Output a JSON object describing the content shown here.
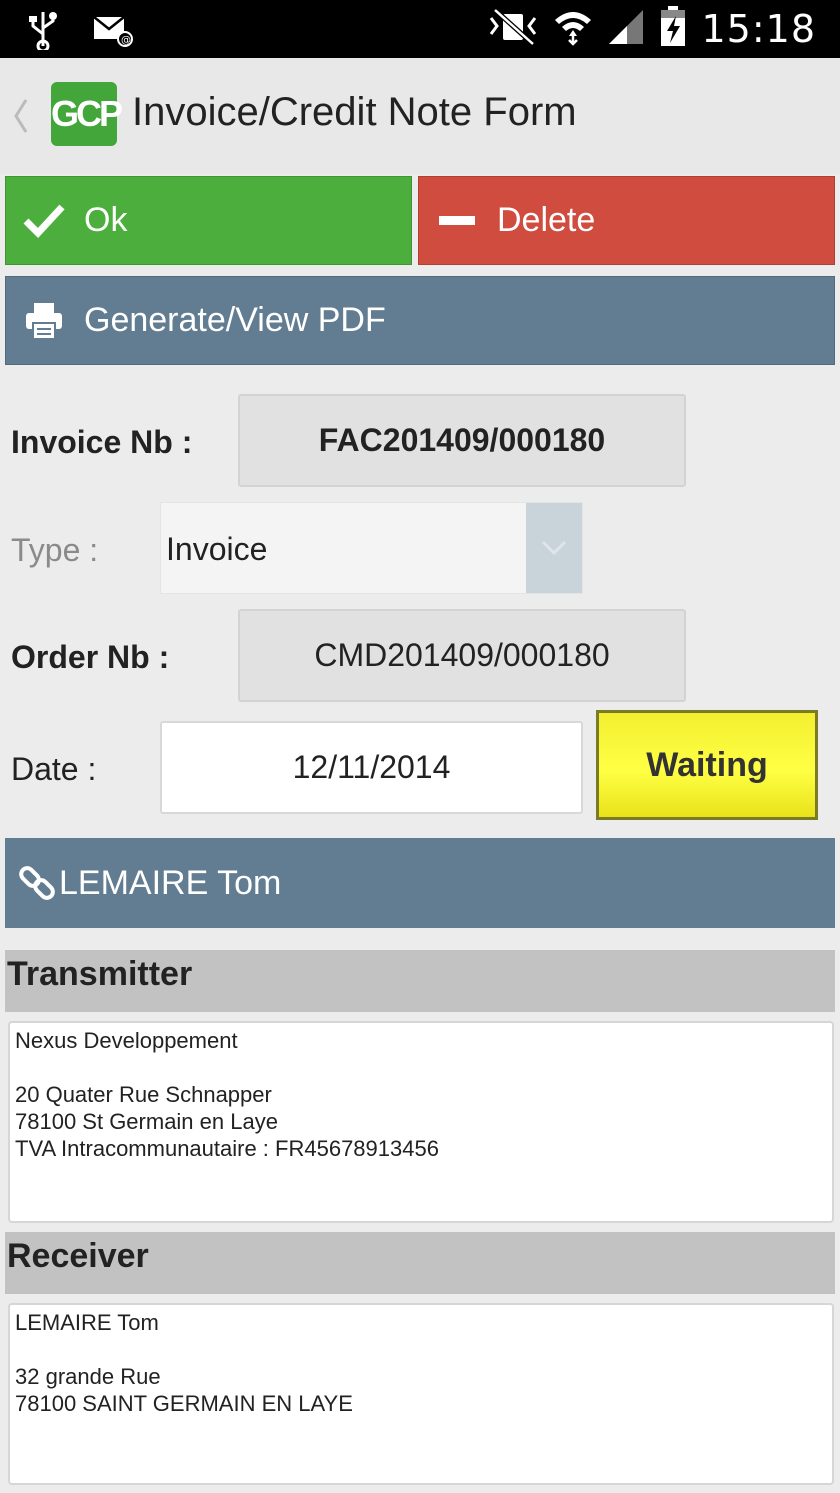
{
  "status_bar": {
    "time": "15:18",
    "icons": [
      "usb-icon",
      "email-icon",
      "mute-icon",
      "wifi-icon",
      "signal-icon",
      "battery-charging-icon"
    ]
  },
  "action_bar": {
    "logo_text": "GCP",
    "title": "Invoice/Credit Note Form"
  },
  "buttons": {
    "ok_label": "Ok",
    "delete_label": "Delete",
    "pdf_label": "Generate/View PDF",
    "ok_color": "#4caf3d",
    "delete_color": "#cf4c3e",
    "pdf_color": "#627d91"
  },
  "form": {
    "invoice_nb_label": "Invoice Nb :",
    "invoice_nb_value": "FAC201409/000180",
    "type_label": "Type :",
    "type_value": "Invoice",
    "order_nb_label": "Order Nb :",
    "order_nb_value": "CMD201409/000180",
    "date_label": "Date :",
    "date_value": "12/11/2014",
    "status_label": "Waiting",
    "status_color": "#ffff44"
  },
  "client": {
    "name": "LEMAIRE Tom"
  },
  "transmitter": {
    "heading": "Transmitter",
    "address": "Nexus Developpement\n\n20 Quater Rue Schnapper\n78100 St Germain en Laye\nTVA Intracommunautaire : FR45678913456"
  },
  "receiver": {
    "heading": "Receiver",
    "address": "LEMAIRE Tom\n\n32 grande Rue\n78100 SAINT GERMAIN EN LAYE"
  }
}
